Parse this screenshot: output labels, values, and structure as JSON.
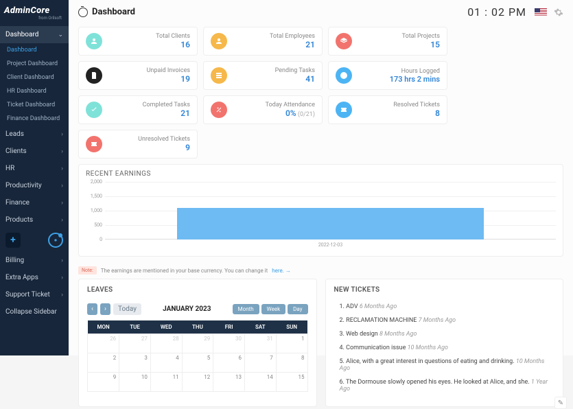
{
  "brand": {
    "title": "AdminCore",
    "sub": "from Orilsoft"
  },
  "sidebar": {
    "main_group": "Dashboard",
    "subs": [
      "Dashboard",
      "Project Dashboard",
      "Client Dashboard",
      "HR Dashboard",
      "Ticket Dashboard",
      "Finance Dashboard"
    ],
    "items": [
      "Leads",
      "Clients",
      "HR",
      "Productivity",
      "Finance",
      "Products"
    ],
    "tail": [
      "Billing",
      "Extra Apps",
      "Support Ticket",
      "Collapse Sidebar"
    ]
  },
  "header": {
    "title": "Dashboard",
    "clock": "01 : 02 PM"
  },
  "cards": [
    {
      "icon": "users",
      "color": "#7fe2d9",
      "label": "Total Clients",
      "value": "16"
    },
    {
      "icon": "users",
      "color": "#f6b84a",
      "label": "Total Employees",
      "value": "21"
    },
    {
      "icon": "layers",
      "color": "#f2736d",
      "label": "Total Projects",
      "value": "15"
    },
    {
      "icon": "invoice",
      "color": "#222",
      "label": "Unpaid Invoices",
      "value": "19"
    },
    {
      "icon": "tasks",
      "color": "#f6b84a",
      "label": "Pending Tasks",
      "value": "41"
    },
    {
      "icon": "clock",
      "color": "#4db4f4",
      "label": "Hours Logged",
      "value": "173 hrs 2 mins"
    },
    {
      "icon": "check",
      "color": "#7fe2d9",
      "label": "Completed Tasks",
      "value": "21"
    },
    {
      "icon": "percent",
      "color": "#f2736d",
      "label": "Today Attendance",
      "value": "0%",
      "extra": " (0/21)"
    },
    {
      "icon": "ticket",
      "color": "#4db4f4",
      "label": "Resolved Tickets",
      "value": "8"
    },
    {
      "icon": "ticket",
      "color": "#f2736d",
      "label": "Unresolved Tickets",
      "value": "9"
    }
  ],
  "earnings": {
    "title": "RECENT EARNINGS"
  },
  "chart_data": {
    "type": "bar",
    "categories": [
      "2022-12-03"
    ],
    "values": [
      1100
    ],
    "title": "RECENT EARNINGS",
    "xlabel": "",
    "ylabel": "",
    "ylim": [
      0,
      2000
    ],
    "yticks": [
      0,
      500,
      1000,
      1500,
      2000
    ]
  },
  "note": {
    "badge": "Note:",
    "text": "The earnings are mentioned in your base currency. You can change it",
    "link": "here."
  },
  "leaves": {
    "title": "LEAVES",
    "prev": "‹",
    "next": "›",
    "today": "Today",
    "month_label": "JANUARY 2023",
    "views": [
      "Month",
      "Week",
      "Day"
    ],
    "dow": [
      "MON",
      "TUE",
      "WED",
      "THU",
      "FRI",
      "SAT",
      "SUN"
    ],
    "rows": [
      [
        "26",
        "27",
        "28",
        "29",
        "30",
        "31",
        "1"
      ],
      [
        "2",
        "3",
        "4",
        "5",
        "6",
        "7",
        "8"
      ],
      [
        "9",
        "10",
        "11",
        "12",
        "13",
        "14",
        "15"
      ]
    ]
  },
  "tickets": {
    "title": "NEW TICKETS",
    "items": [
      {
        "n": "1.",
        "t": "ADV",
        "ago": "6 Months Ago"
      },
      {
        "n": "2.",
        "t": "RECLAMATION MACHINE",
        "ago": "7 Months Ago"
      },
      {
        "n": "3.",
        "t": "Web design",
        "ago": "8 Months Ago"
      },
      {
        "n": "4.",
        "t": "Communication issue",
        "ago": "10 Months Ago"
      },
      {
        "n": "5.",
        "t": "Alice, with a great interest in questions of eating and drinking.",
        "ago": "10 Months Ago"
      },
      {
        "n": "6.",
        "t": "The Dormouse slowly opened his eyes. He looked at Alice, and she.",
        "ago": "1 Year Ago"
      }
    ]
  }
}
